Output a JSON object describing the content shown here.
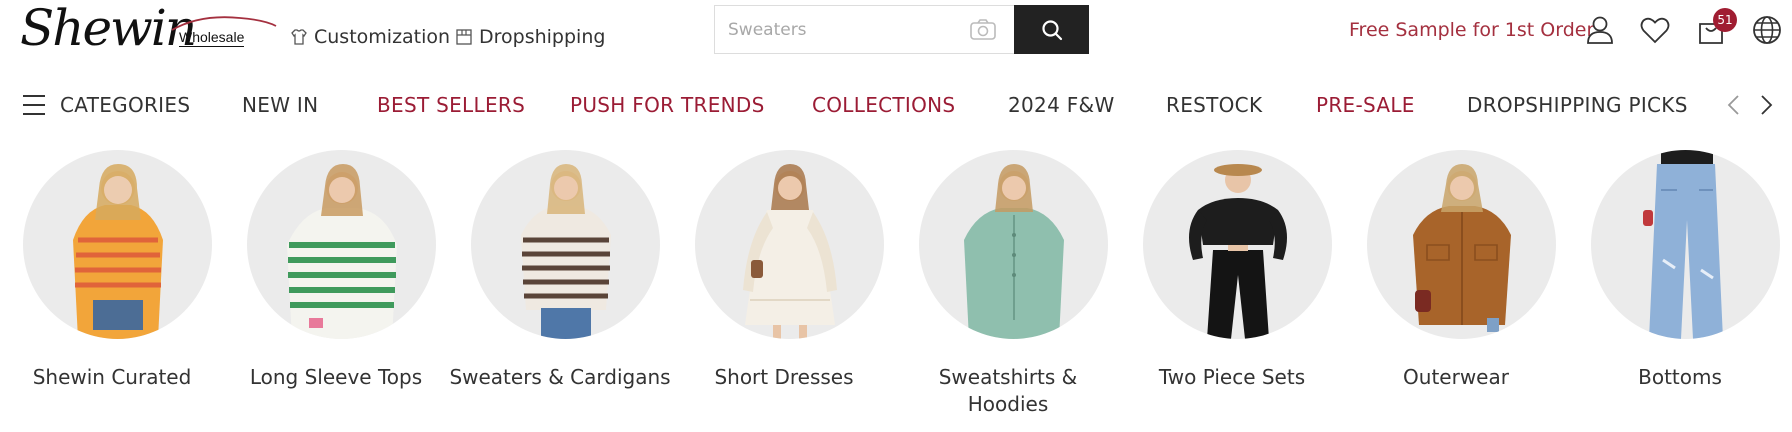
{
  "header": {
    "logo_text": "Shewin",
    "logo_sub": "Wholesale",
    "links": [
      {
        "label": "Customization",
        "icon": "shirt-icon"
      },
      {
        "label": "Dropshipping",
        "icon": "box-icon"
      }
    ],
    "search": {
      "placeholder": "Sweaters",
      "icons": [
        "camera-icon",
        "search-icon"
      ]
    },
    "promo": "Free Sample for 1st Order",
    "cart_badge": "51",
    "icons": [
      "user-icon",
      "heart-icon",
      "cart-icon",
      "globe-icon"
    ],
    "accent_color": "#a4303f"
  },
  "nav": {
    "menu_label": "CATEGORIES",
    "items": [
      {
        "label": "NEW IN",
        "color": "#333333"
      },
      {
        "label": "BEST SELLERS",
        "color": "#9b1c35"
      },
      {
        "label": "PUSH FOR TRENDS",
        "color": "#9b1c35"
      },
      {
        "label": "COLLECTIONS",
        "color": "#9b1c35"
      },
      {
        "label": "2024 F&W",
        "color": "#333333"
      },
      {
        "label": "RESTOCK",
        "color": "#333333"
      },
      {
        "label": "PRE-SALE",
        "color": "#9b1c35"
      },
      {
        "label": "DROPSHIPPING PICKS",
        "color": "#333333"
      }
    ],
    "arrows": [
      "chevron-left-icon",
      "chevron-right-icon"
    ]
  },
  "categories": [
    {
      "label": "Shewin Curated",
      "image": "orange-striped-sweater-photo"
    },
    {
      "label": "Long Sleeve Tops",
      "image": "green-striped-top-photo"
    },
    {
      "label": "Sweaters & Cardigans",
      "image": "brown-striped-sweater-photo"
    },
    {
      "label": "Short Dresses",
      "image": "cream-dress-photo"
    },
    {
      "label": "Sweatshirts & Hoodies",
      "image": "sage-sweatshirt-photo"
    },
    {
      "label": "Two Piece Sets",
      "image": "black-two-piece-photo"
    },
    {
      "label": "Outerwear",
      "image": "brown-shacket-photo"
    },
    {
      "label": "Bottoms",
      "image": "blue-jeans-photo"
    }
  ]
}
